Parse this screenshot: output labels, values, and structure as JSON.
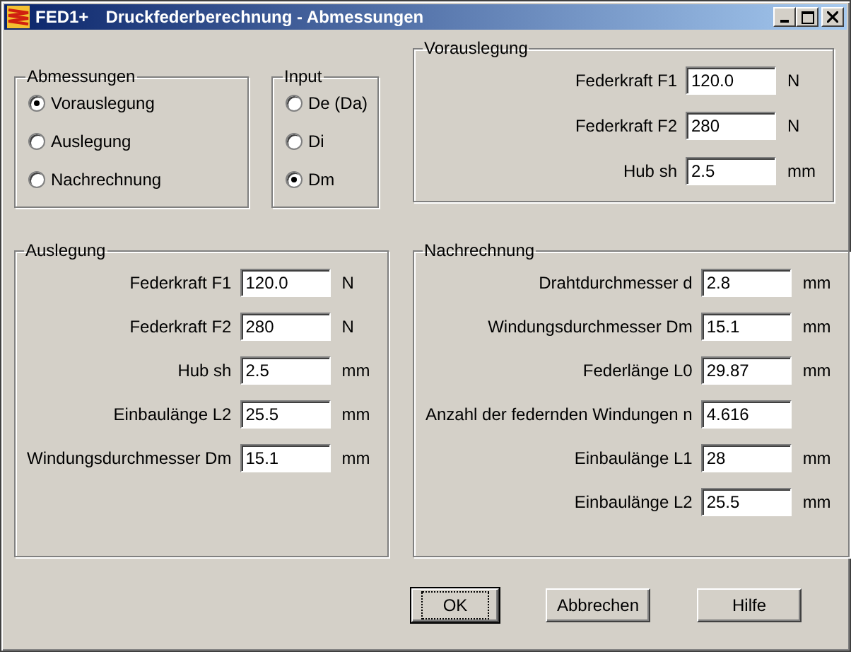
{
  "window": {
    "title_app": "FED1+",
    "title": "Druckfederberechnung - Abmessungen"
  },
  "abmessungen": {
    "title": "Abmessungen",
    "options": [
      {
        "label": "Vorauslegung",
        "selected": true
      },
      {
        "label": "Auslegung",
        "selected": false
      },
      {
        "label": "Nachrechnung",
        "selected": false
      }
    ]
  },
  "input": {
    "title": "Input",
    "options": [
      {
        "label": "De (Da)",
        "selected": false
      },
      {
        "label": "Di",
        "selected": false
      },
      {
        "label": "Dm",
        "selected": true
      }
    ]
  },
  "vorauslegung": {
    "title": "Vorauslegung",
    "rows": [
      {
        "label": "Federkraft F1",
        "value": "120.0",
        "unit": "N"
      },
      {
        "label": "Federkraft F2",
        "value": "280",
        "unit": "N"
      },
      {
        "label": "Hub sh",
        "value": "2.5",
        "unit": "mm"
      }
    ]
  },
  "auslegung": {
    "title": "Auslegung",
    "rows": [
      {
        "label": "Federkraft F1",
        "value": "120.0",
        "unit": "N"
      },
      {
        "label": "Federkraft F2",
        "value": "280",
        "unit": "N"
      },
      {
        "label": "Hub sh",
        "value": "2.5",
        "unit": "mm"
      },
      {
        "label": "Einbaulänge L2",
        "value": "25.5",
        "unit": "mm"
      },
      {
        "label": "Windungsdurchmesser Dm",
        "value": "15.1",
        "unit": "mm"
      }
    ]
  },
  "nachrechnung": {
    "title": "Nachrechnung",
    "rows": [
      {
        "label": "Drahtdurchmesser d",
        "value": "2.8",
        "unit": "mm"
      },
      {
        "label": "Windungsdurchmesser Dm",
        "value": "15.1",
        "unit": "mm"
      },
      {
        "label": "Federlänge L0",
        "value": "29.87",
        "unit": "mm"
      },
      {
        "label": "Anzahl der federnden Windungen n",
        "value": "4.616"
      },
      {
        "label": "Einbaulänge L1",
        "value": "28",
        "unit": "mm"
      },
      {
        "label": "Einbaulänge L2",
        "value": "25.5",
        "unit": "mm"
      }
    ]
  },
  "buttons": [
    {
      "label": "OK",
      "focused": true
    },
    {
      "label": "Abbrechen",
      "focused": false
    },
    {
      "label": "Hilfe",
      "focused": false
    }
  ]
}
